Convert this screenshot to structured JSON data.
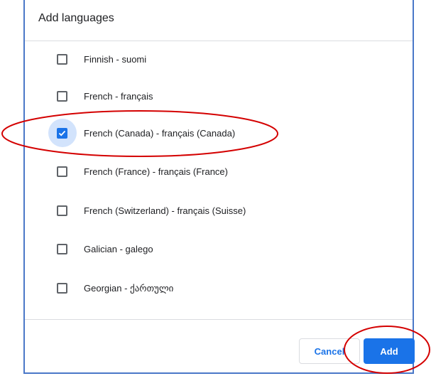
{
  "dialog": {
    "title": "Add languages",
    "languages": [
      {
        "label": "Finnish - suomi",
        "checked": false
      },
      {
        "label": "French - français",
        "checked": false
      },
      {
        "label": "French (Canada) - français (Canada)",
        "checked": true
      },
      {
        "label": "French (France) - français (France)",
        "checked": false
      },
      {
        "label": "French (Switzerland) - français (Suisse)",
        "checked": false
      },
      {
        "label": "Galician - galego",
        "checked": false
      },
      {
        "label": "Georgian - ქართული",
        "checked": false
      }
    ],
    "cancel_label": "Cancel",
    "add_label": "Add"
  },
  "colors": {
    "accent": "#1a73e8",
    "annotation": "#d40000",
    "dialog_border": "#4a78c8"
  }
}
